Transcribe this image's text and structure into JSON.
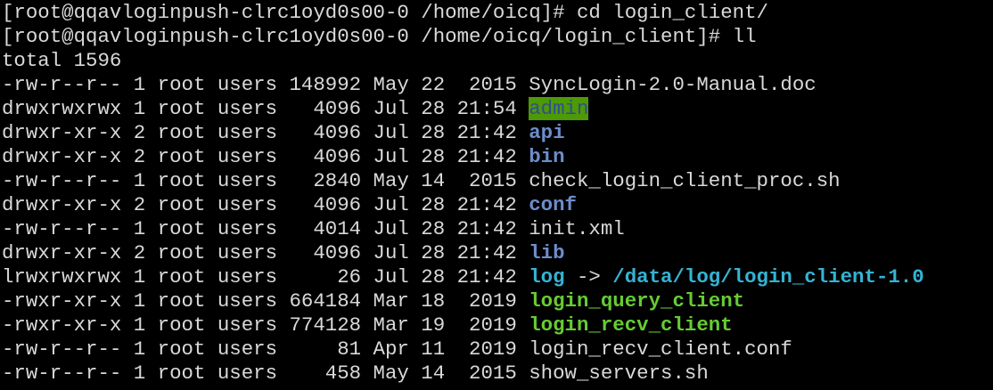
{
  "window": {
    "background": "#000000",
    "text_color": "#d9d9d9"
  },
  "colors": {
    "directory": "#6d8dcb",
    "executable": "#66cc33",
    "symlink": "#35b3d4",
    "sticky_other_writable_bg": "#4d9a06"
  },
  "prompt1": {
    "prompt": "[root@qqavloginpush-clrc1oyd0s00-0 /home/oicq]# ",
    "command": "cd login_client/"
  },
  "prompt2": {
    "prompt": "[root@qqavloginpush-clrc1oyd0s00-0 /home/oicq/login_client]# ",
    "command": "ll"
  },
  "total": "total 1596",
  "entries": [
    {
      "meta": "-rw-r--r-- 1 root users 148992 May 22  2015 ",
      "name": "SyncLogin-2.0-Manual.doc",
      "type": "file"
    },
    {
      "meta": "drwxrwxrwx 1 root users   4096 Jul 28 21:54 ",
      "name": "admin",
      "type": "dir-other-writable"
    },
    {
      "meta": "drwxr-xr-x 2 root users   4096 Jul 28 21:42 ",
      "name": "api",
      "type": "dir"
    },
    {
      "meta": "drwxr-xr-x 2 root users   4096 Jul 28 21:42 ",
      "name": "bin",
      "type": "dir"
    },
    {
      "meta": "-rw-r--r-- 1 root users   2840 May 14  2015 ",
      "name": "check_login_client_proc.sh",
      "type": "file"
    },
    {
      "meta": "drwxr-xr-x 2 root users   4096 Jul 28 21:42 ",
      "name": "conf",
      "type": "dir"
    },
    {
      "meta": "-rw-r--r-- 1 root users   4014 Jul 28 21:42 ",
      "name": "init.xml",
      "type": "file"
    },
    {
      "meta": "drwxr-xr-x 2 root users   4096 Jul 28 21:42 ",
      "name": "lib",
      "type": "dir"
    },
    {
      "meta": "lrwxrwxrwx 1 root users     26 Jul 28 21:42 ",
      "name": "log",
      "type": "symlink",
      "arrow": " -> ",
      "target": "/data/log/login_client-1.0"
    },
    {
      "meta": "-rwxr-xr-x 1 root users 664184 Mar 18  2019 ",
      "name": "login_query_client",
      "type": "exec"
    },
    {
      "meta": "-rwxr-xr-x 1 root users 774128 Mar 19  2019 ",
      "name": "login_recv_client",
      "type": "exec"
    },
    {
      "meta": "-rw-r--r-- 1 root users     81 Apr 11  2019 ",
      "name": "login_recv_client.conf",
      "type": "file"
    },
    {
      "meta": "-rw-r--r-- 1 root users    458 May 14  2015 ",
      "name": "show_servers.sh",
      "type": "file"
    }
  ]
}
